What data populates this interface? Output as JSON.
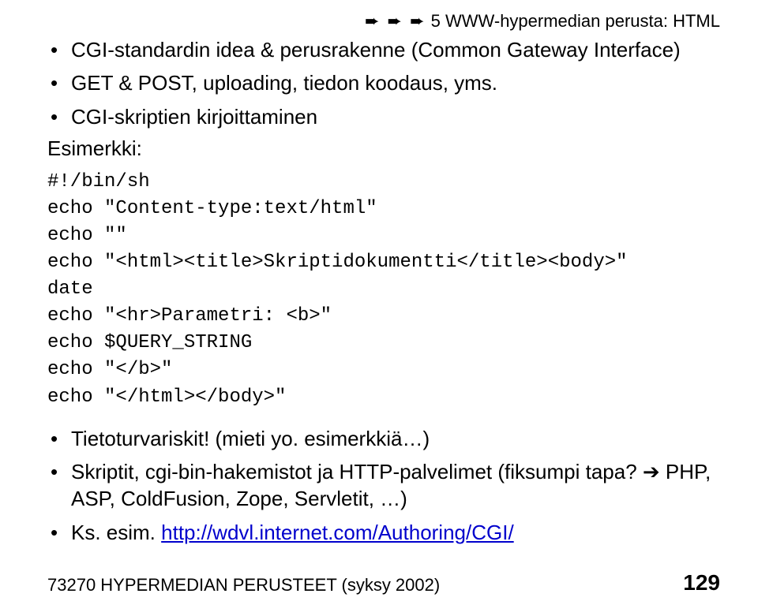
{
  "header": {
    "arrows": "➨ ➨ ➨",
    "text": " 5 WWW-hypermedian perusta: HTML"
  },
  "bullets_top": [
    "CGI-standardin idea & perusrakenne (Common Gateway Interface)",
    "GET & POST, uploading, tiedon koodaus, yms.",
    "CGI-skriptien kirjoittaminen"
  ],
  "example_label": "Esimerkki:",
  "code": "#!/bin/sh\necho \"Content-type:text/html\"\necho \"\"\necho \"<html><title>Skriptidokumentti</title><body>\"\ndate\necho \"<hr>Parametri: <b>\"\necho $QUERY_STRING\necho \"</b>\"\necho \"</html></body>\"",
  "bullets_bottom": {
    "item1": "Tietoturvariskit! (mieti yo. esimerkkiä…)",
    "item2_prefix": "Skriptit, cgi-bin-hakemistot ja HTTP-palvelimet (fiksumpi tapa? ",
    "item2_arrow": "➔",
    "item2_suffix": " PHP, ASP, ColdFusion, Zope, Servletit, …)",
    "item3_prefix": "Ks. esim. ",
    "item3_link": "http://wdvl.internet.com/Authoring/CGI/"
  },
  "footer": {
    "left": "73270 HYPERMEDIAN PERUSTEET (syksy 2002)",
    "right": "129"
  }
}
